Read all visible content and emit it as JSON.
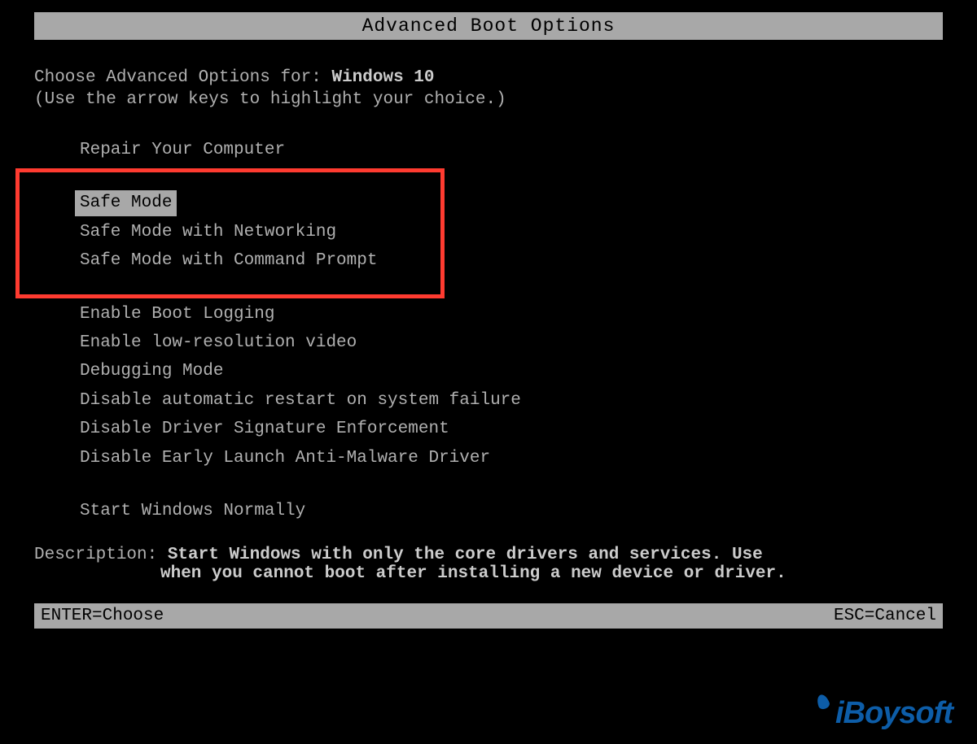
{
  "title": "Advanced Boot Options",
  "instruction_prefix": "Choose Advanced Options for: ",
  "os_name": "Windows 10",
  "hint": "(Use the arrow keys to highlight your choice.)",
  "option_groups": [
    {
      "items": [
        {
          "label": "Repair Your Computer",
          "selected": false
        }
      ]
    },
    {
      "items": [
        {
          "label": "Safe Mode",
          "selected": true
        },
        {
          "label": "Safe Mode with Networking",
          "selected": false
        },
        {
          "label": "Safe Mode with Command Prompt",
          "selected": false
        }
      ],
      "highlighted": true
    },
    {
      "items": [
        {
          "label": "Enable Boot Logging",
          "selected": false
        },
        {
          "label": "Enable low-resolution video",
          "selected": false
        },
        {
          "label": "Debugging Mode",
          "selected": false
        },
        {
          "label": "Disable automatic restart on system failure",
          "selected": false
        },
        {
          "label": "Disable Driver Signature Enforcement",
          "selected": false
        },
        {
          "label": "Disable Early Launch Anti-Malware Driver",
          "selected": false
        }
      ]
    },
    {
      "items": [
        {
          "label": "Start Windows Normally",
          "selected": false
        }
      ]
    }
  ],
  "description_label": "Description: ",
  "description_line1": "Start Windows with only the core drivers and services. Use",
  "description_line2": "when you cannot boot after installing a new device or driver.",
  "footer_left": "ENTER=Choose",
  "footer_right": "ESC=Cancel",
  "watermark": "iBoysoft"
}
